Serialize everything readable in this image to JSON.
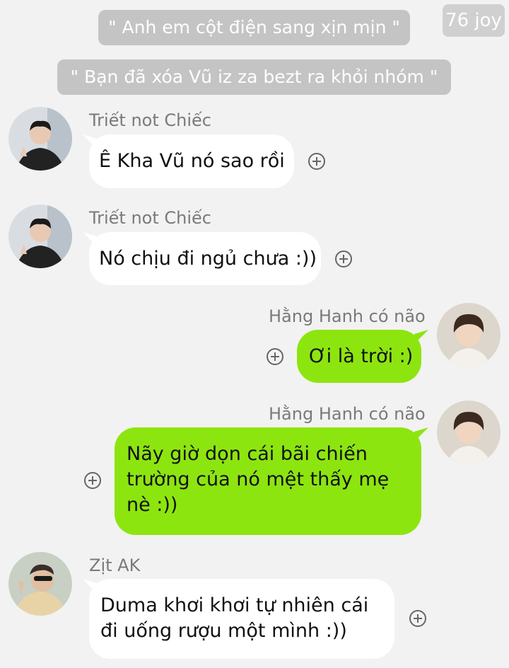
{
  "watermark": "76 joy",
  "system_notices": [
    "\" Anh em cột điện sang xịn mịn \"",
    "\" Bạn đã xóa Vũ iz za bezt ra khỏi nhóm \""
  ],
  "messages": [
    {
      "sender": "Triết not Chiếc",
      "text": "Ê Kha Vũ nó sao rồi",
      "direction": "incoming"
    },
    {
      "sender": "Triết not Chiếc",
      "text": "Nó chịu đi ngủ chưa :))",
      "direction": "incoming"
    },
    {
      "sender": "Hằng Hanh có não",
      "text": "Ơi là trời :)",
      "direction": "outgoing"
    },
    {
      "sender": "Hằng Hanh có não",
      "lines": [
        "Nãy giờ dọn cái bãi chiến",
        "trường của nó mệt thấy mẹ",
        "nè :))"
      ],
      "direction": "outgoing"
    },
    {
      "sender": "Zịt AK",
      "lines": [
        "Duma khơi khơi tự nhiên cái",
        "đi uống rượu một mình :))"
      ],
      "direction": "incoming"
    }
  ],
  "colors": {
    "background": "#f2f2f2",
    "outgoing_bubble": "#8de510",
    "incoming_bubble": "#ffffff",
    "system_pill": "#c4c4c4"
  },
  "icons": [
    "add-reaction-icon",
    "avatar-photo"
  ]
}
